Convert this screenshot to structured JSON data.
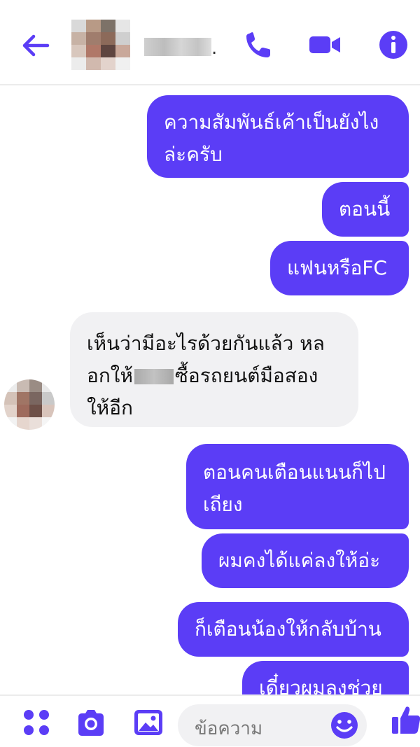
{
  "header": {
    "contact_name_suffix": ".",
    "icons": [
      "back-arrow-icon",
      "phone-icon",
      "video-camera-icon",
      "info-icon"
    ],
    "accent_color": "#5b3df6"
  },
  "messages": [
    {
      "direction": "outgoing",
      "text": "ความสัมพันธ์เค้าเป็นยังไง\nล่ะครับ"
    },
    {
      "direction": "outgoing",
      "text": "ตอนนี้"
    },
    {
      "direction": "outgoing",
      "text": "แฟนหรือFC"
    },
    {
      "direction": "incoming",
      "text_line1": "เห็นว่ามีอะไรด้วยกันแล้ว หล",
      "text_line2a": "อกให้",
      "text_line2b": "ซื้อรถยนต์มือสอง",
      "text_line3": "ให้อีก"
    },
    {
      "direction": "outgoing",
      "text": "ตอนคนเตือนแนนก็ไป\nเถียง"
    },
    {
      "direction": "outgoing",
      "text": "ผมคงได้แค่ลงให้อ่ะ"
    },
    {
      "direction": "outgoing",
      "text": "ก็เตือนน้องให้กลับบ้าน"
    },
    {
      "direction": "outgoing",
      "text": "เดี๋ยวผมลงช่วย"
    }
  ],
  "composer": {
    "placeholder": "ข้อความ",
    "icons": [
      "apps-icon",
      "camera-icon",
      "gallery-icon",
      "emoji-icon",
      "thumbs-up-icon"
    ]
  }
}
